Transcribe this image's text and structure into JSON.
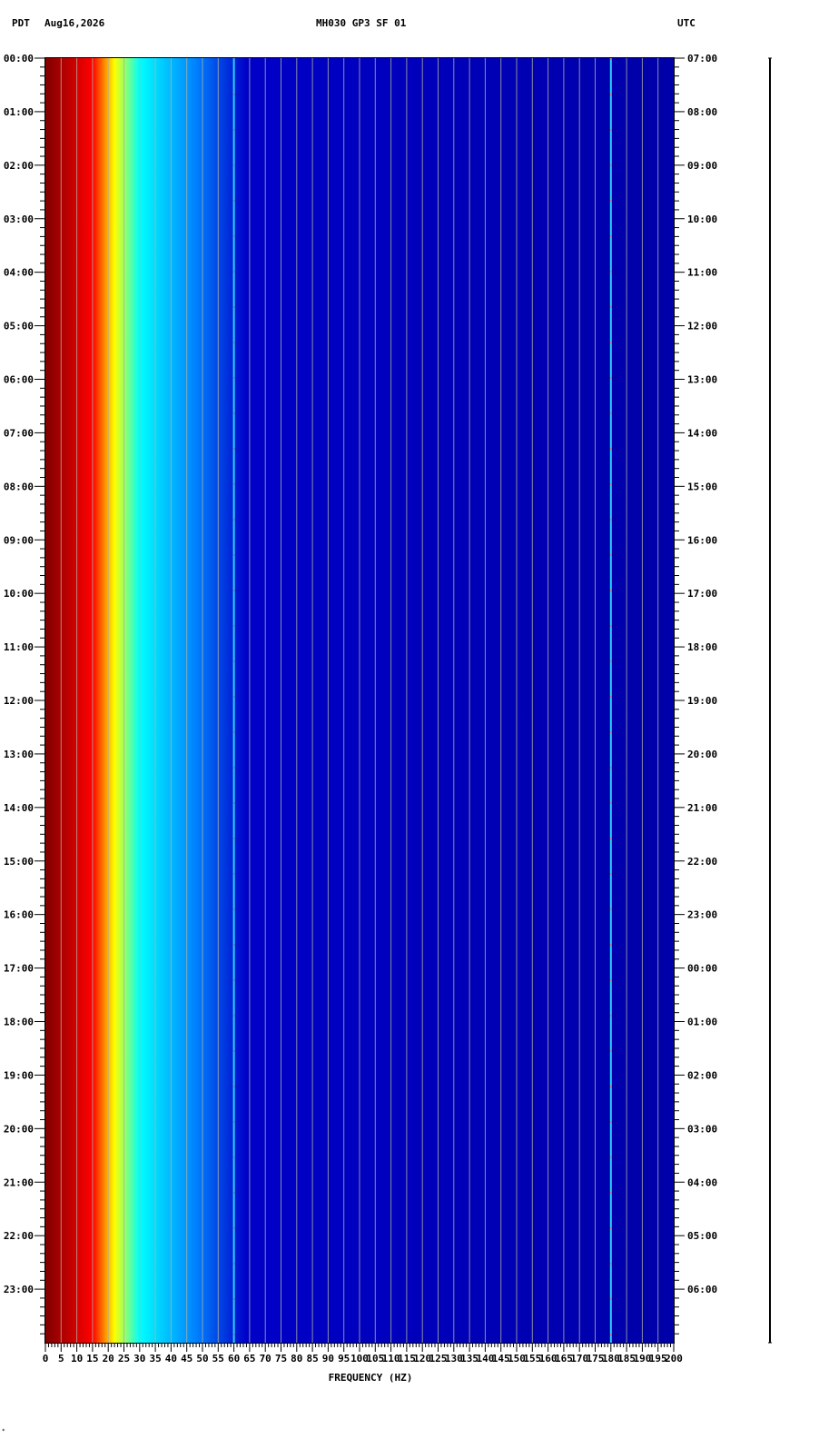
{
  "header": {
    "left_tz": "PDT",
    "date": "Aug16,2026",
    "station": "MH030 GP3 SF 01",
    "right_tz": "UTC"
  },
  "footer_mark": "*",
  "chart_data": {
    "type": "heatmap",
    "title": "MH030 GP3 SF 01",
    "xlabel": "FREQUENCY (HZ)",
    "xlim": [
      0,
      200
    ],
    "x_tick_step": 5,
    "x_tick_labels": [
      "0",
      "5",
      "10",
      "15",
      "20",
      "25",
      "30",
      "35",
      "40",
      "45",
      "50",
      "55",
      "60",
      "65",
      "70",
      "75",
      "80",
      "85",
      "90",
      "95",
      "100",
      "105",
      "110",
      "115",
      "120",
      "125",
      "130",
      "135",
      "140",
      "145",
      "150",
      "155",
      "160",
      "165",
      "170",
      "175",
      "180",
      "185",
      "190",
      "195",
      "200"
    ],
    "y_left_label": "PDT",
    "y_right_label": "UTC",
    "y_left_ticks": [
      "00:00",
      "01:00",
      "02:00",
      "03:00",
      "04:00",
      "05:00",
      "06:00",
      "07:00",
      "08:00",
      "09:00",
      "10:00",
      "11:00",
      "12:00",
      "13:00",
      "14:00",
      "15:00",
      "16:00",
      "17:00",
      "18:00",
      "19:00",
      "20:00",
      "21:00",
      "22:00",
      "23:00"
    ],
    "y_right_ticks": [
      "07:00",
      "08:00",
      "09:00",
      "10:00",
      "11:00",
      "12:00",
      "13:00",
      "14:00",
      "15:00",
      "16:00",
      "17:00",
      "18:00",
      "19:00",
      "20:00",
      "21:00",
      "22:00",
      "23:00",
      "00:00",
      "01:00",
      "02:00",
      "03:00",
      "04:00",
      "05:00",
      "06:00"
    ],
    "hours_span": 24,
    "gridlines_every_hz": 5,
    "spectral_lines_hz": [
      60,
      180
    ],
    "colormap": [
      "#7f0000",
      "#ff0000",
      "#ffff00",
      "#00ffff",
      "#0080ff",
      "#0000c8",
      "#0000a8"
    ],
    "grid_color": "#b0b0a0",
    "background_color": "#0000b4"
  }
}
